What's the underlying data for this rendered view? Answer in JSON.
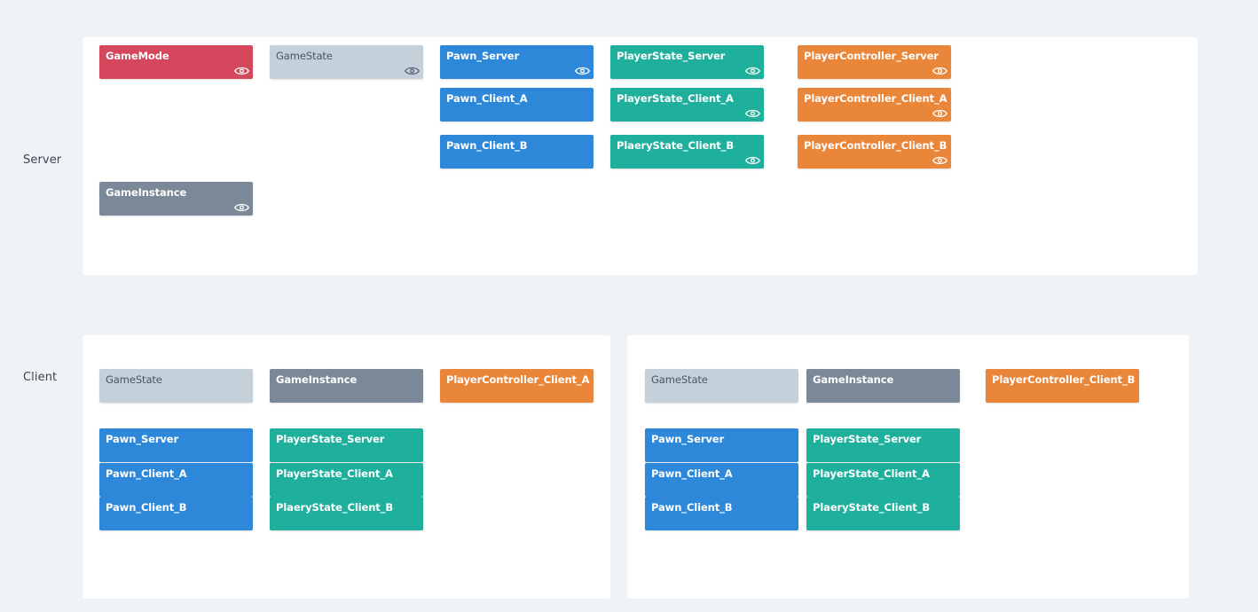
{
  "labels": {
    "server": "Server",
    "client": "Client"
  },
  "colors": {
    "game_mode": "#d4475d",
    "game_state": "#c4d0da",
    "pawn": "#2e88da",
    "player_state": "#1eb09c",
    "player_controller": "#ea863a",
    "game_instance": "#7a8897",
    "background": "#f0f3f6",
    "panel": "#ffffff"
  },
  "server": {
    "game_mode": "GameMode",
    "game_state": "GameState",
    "pawn_server": "Pawn_Server",
    "pawn_client_a": "Pawn_Client_A",
    "pawn_client_b": "Pawn_Client_B",
    "player_state_server": "PlayerState_Server",
    "player_state_client_a": "PlayerState_Client_A",
    "player_state_client_b": "PlaeryState_Client_B",
    "player_controller_server": "PlayerController_Server",
    "player_controller_client_a": "PlayerController_Client_A",
    "player_controller_client_b": "PlayerController_Client_B",
    "game_instance": "GameInstance",
    "eye_icon": "eye-icon"
  },
  "client_a": {
    "game_state": "GameState",
    "game_instance": "GameInstance",
    "player_controller": "PlayerController_Client_A",
    "pawn_server": "Pawn_Server",
    "pawn_client_a": "Pawn_Client_A",
    "pawn_client_b": "Pawn_Client_B",
    "player_state_server": "PlayerState_Server",
    "player_state_client_a": "PlayerState_Client_A",
    "player_state_client_b": "PlaeryState_Client_B"
  },
  "client_b": {
    "game_state": "GameState",
    "game_instance": "GameInstance",
    "player_controller": "PlayerController_Client_B",
    "pawn_server": "Pawn_Server",
    "pawn_client_a": "Pawn_Client_A",
    "pawn_client_b": "Pawn_Client_B",
    "player_state_server": "PlayerState_Server",
    "player_state_client_a": "PlayerState_Client_A",
    "player_state_client_b": "PlaeryState_Client_B"
  }
}
